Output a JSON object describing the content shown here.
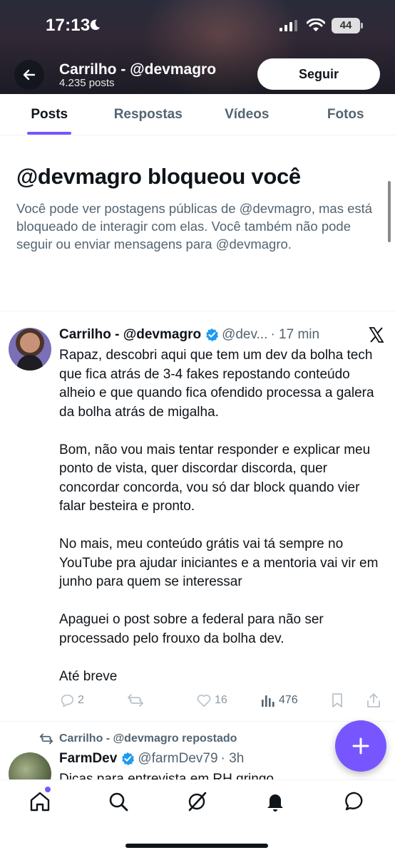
{
  "status_bar": {
    "time": "17:13",
    "battery": "44"
  },
  "header": {
    "title": "Carrilho - @devmagro",
    "posts_count": "4.235 posts",
    "follow_label": "Seguir"
  },
  "tabs": [
    {
      "label": "Posts",
      "active": true
    },
    {
      "label": "Respostas",
      "active": false
    },
    {
      "label": "Vídeos",
      "active": false
    },
    {
      "label": "Fotos",
      "active": false
    }
  ],
  "blocked": {
    "title": "@devmagro bloqueou você",
    "message": "Você pode ver postagens públicas de @devmagro, mas está bloqueado de interagir com elas. Você também não pode seguir ou enviar mensagens para @devmagro."
  },
  "tweet": {
    "name": "Carrilho - @devmagro",
    "handle": "@dev...",
    "time": "· 17 min",
    "paragraphs": [
      "Rapaz, descobri aqui que tem um dev da bolha tech que fica atrás de 3-4 fakes repostando conteúdo alheio e que quando fica ofendido processa a galera da bolha atrás de migalha.",
      "Bom, não vou mais tentar responder e explicar meu ponto de vista, quer discordar discorda, quer concordar concorda, vou só dar block quando vier falar besteira e pronto.",
      "No mais, meu conteúdo grátis vai tá sempre no YouTube pra ajudar iniciantes e a mentoria vai vir em junho para quem se interessar",
      "Apaguei o post sobre a federal para não ser processado pelo frouxo da bolha dev.",
      "Até breve"
    ],
    "replies": "2",
    "likes": "16",
    "views": "476"
  },
  "tweet2": {
    "repost_label": "Carrilho - @devmagro repostado",
    "name": "FarmDev",
    "handle": "@farmDev79",
    "time": "· 3h",
    "text": "Dicas para entrevista em RH gringo"
  },
  "colors": {
    "accent": "#7856ff",
    "muted": "#536471",
    "verified": "#1d9bf0"
  }
}
